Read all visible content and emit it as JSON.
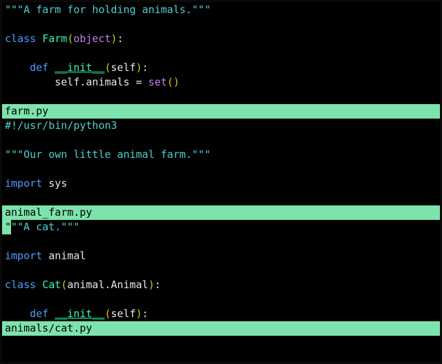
{
  "panes": [
    {
      "status": "farm.py",
      "lines": [
        {
          "id": "p0l0",
          "tokens": [
            {
              "t": "\"\"\"A farm for holding animals.\"\"\"",
              "cls": "c-str"
            }
          ]
        },
        {
          "id": "p0l1",
          "tokens": []
        },
        {
          "id": "p0l2",
          "tokens": [
            {
              "t": "class",
              "cls": "c-kw"
            },
            {
              "t": " ",
              "cls": "c-plain"
            },
            {
              "t": "Farm",
              "cls": "c-ident"
            },
            {
              "t": "(",
              "cls": "c-paren"
            },
            {
              "t": "object",
              "cls": "c-builtin"
            },
            {
              "t": ")",
              "cls": "c-paren"
            },
            {
              "t": ":",
              "cls": "c-plain"
            }
          ]
        },
        {
          "id": "p0l3",
          "tokens": []
        },
        {
          "id": "p0l4",
          "tokens": [
            {
              "t": "    ",
              "cls": "c-plain"
            },
            {
              "t": "def",
              "cls": "c-kw"
            },
            {
              "t": " ",
              "cls": "c-plain"
            },
            {
              "t": "__init__",
              "cls": "c-ident c-ul"
            },
            {
              "t": "(",
              "cls": "c-paren"
            },
            {
              "t": "self",
              "cls": "c-plain"
            },
            {
              "t": ")",
              "cls": "c-paren"
            },
            {
              "t": ":",
              "cls": "c-plain"
            }
          ]
        },
        {
          "id": "p0l5",
          "tokens": [
            {
              "t": "        self.animals ",
              "cls": "c-plain"
            },
            {
              "t": "=",
              "cls": "c-op"
            },
            {
              "t": " ",
              "cls": "c-plain"
            },
            {
              "t": "set",
              "cls": "c-builtin"
            },
            {
              "t": "()",
              "cls": "c-paren"
            }
          ]
        },
        {
          "id": "p0l6",
          "tokens": []
        }
      ]
    },
    {
      "status": "animal_farm.py",
      "lines": [
        {
          "id": "p1l0",
          "tokens": [
            {
              "t": "#!/usr/bin/python3",
              "cls": "c-shebang"
            }
          ]
        },
        {
          "id": "p1l1",
          "tokens": []
        },
        {
          "id": "p1l2",
          "tokens": [
            {
              "t": "\"\"\"Our own little animal farm.\"\"\"",
              "cls": "c-str"
            }
          ]
        },
        {
          "id": "p1l3",
          "tokens": []
        },
        {
          "id": "p1l4",
          "tokens": [
            {
              "t": "import",
              "cls": "c-kw"
            },
            {
              "t": " sys",
              "cls": "c-plain"
            }
          ]
        },
        {
          "id": "p1l5",
          "tokens": []
        }
      ]
    },
    {
      "status": "animals/cat.py",
      "cursor": true,
      "lines": [
        {
          "id": "p2l0",
          "cursor_char": "\"",
          "tokens_after": [
            {
              "t": "\"\"A cat.\"\"\"",
              "cls": "c-str"
            }
          ]
        },
        {
          "id": "p2l1",
          "tokens": []
        },
        {
          "id": "p2l2",
          "tokens": [
            {
              "t": "import",
              "cls": "c-kw"
            },
            {
              "t": " animal",
              "cls": "c-plain"
            }
          ]
        },
        {
          "id": "p2l3",
          "tokens": []
        },
        {
          "id": "p2l4",
          "tokens": [
            {
              "t": "class",
              "cls": "c-kw"
            },
            {
              "t": " ",
              "cls": "c-plain"
            },
            {
              "t": "Cat",
              "cls": "c-ident"
            },
            {
              "t": "(",
              "cls": "c-paren"
            },
            {
              "t": "animal.Animal",
              "cls": "c-plain"
            },
            {
              "t": ")",
              "cls": "c-paren"
            },
            {
              "t": ":",
              "cls": "c-plain"
            }
          ]
        },
        {
          "id": "p2l5",
          "tokens": []
        },
        {
          "id": "p2l6",
          "tokens": [
            {
              "t": "    ",
              "cls": "c-plain"
            },
            {
              "t": "def",
              "cls": "c-kw"
            },
            {
              "t": " ",
              "cls": "c-plain"
            },
            {
              "t": "__init__",
              "cls": "c-ident c-ul"
            },
            {
              "t": "(",
              "cls": "c-paren"
            },
            {
              "t": "self",
              "cls": "c-plain"
            },
            {
              "t": ")",
              "cls": "c-paren"
            },
            {
              "t": ":",
              "cls": "c-plain"
            }
          ]
        }
      ]
    }
  ]
}
